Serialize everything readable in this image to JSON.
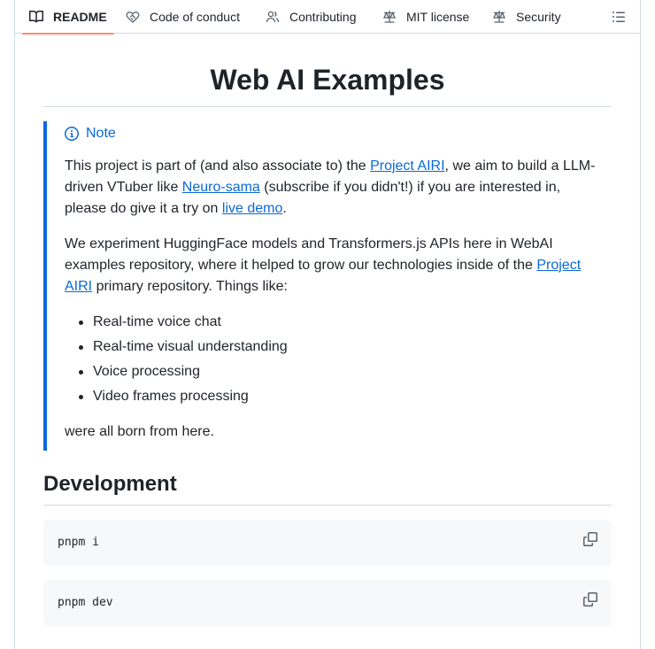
{
  "tabs": [
    {
      "label": "README",
      "icon": "book-icon",
      "active": true
    },
    {
      "label": "Code of conduct",
      "icon": "heart-handshake-icon"
    },
    {
      "label": "Contributing",
      "icon": "people-icon"
    },
    {
      "label": "MIT license",
      "icon": "law-scale-icon"
    },
    {
      "label": "Security",
      "icon": "law-scale-icon"
    }
  ],
  "toc_icon": "list-unordered-icon",
  "readme": {
    "title": "Web AI Examples",
    "note": {
      "label": "Note",
      "p1": {
        "t1": "This project is part of (and also associate to) the ",
        "link1": "Project AIRI",
        "t2": ", we aim to build a LLM-driven VTuber like ",
        "link2": "Neuro-sama",
        "t3": " (subscribe if you didn't!) if you are interested in, please do give it a try on ",
        "link3": "live demo",
        "t4": "."
      },
      "p2": {
        "t1": "We experiment HuggingFace models and Transformers.js APIs here in WebAI examples repository, where it helped to grow our technologies inside of the ",
        "link1": "Project AIRI",
        "t2": " primary repository. Things like:"
      },
      "list": [
        "Real-time voice chat",
        "Real-time visual understanding",
        "Voice processing",
        "Video frames processing"
      ],
      "p3": "were all born from here."
    },
    "development": {
      "heading": "Development",
      "code_blocks": [
        {
          "code": "pnpm i"
        },
        {
          "code": "pnpm dev"
        }
      ],
      "copy_icon": "copy-icon"
    }
  },
  "colors": {
    "link": "#0969da",
    "note_accent": "#0969da",
    "active_tab_underline": "#fd8c73",
    "border": "#d1d9e0",
    "code_bg": "#f6f8fa"
  }
}
